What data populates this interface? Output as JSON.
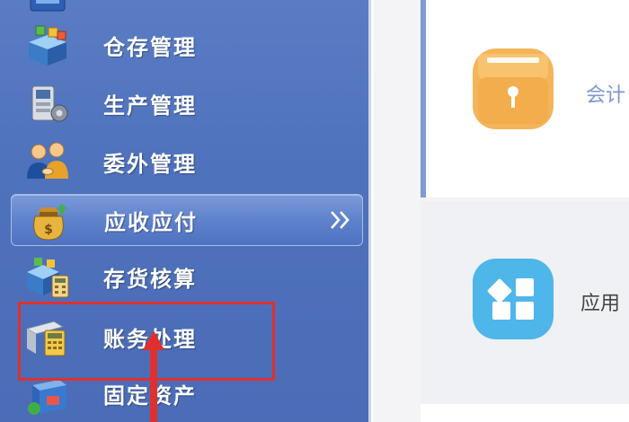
{
  "sidebar": {
    "items": [
      {
        "label": "",
        "icon": "partial-top-icon"
      },
      {
        "label": "仓存管理",
        "icon": "warehouse-boxes-icon"
      },
      {
        "label": "生产管理",
        "icon": "production-machine-icon"
      },
      {
        "label": "委外管理",
        "icon": "outsourcing-people-icon"
      },
      {
        "label": "应收应付",
        "icon": "money-bag-icon",
        "active": true,
        "chevron": "»"
      },
      {
        "label": "存货核算",
        "icon": "inventory-calculator-icon"
      },
      {
        "label": "账务处理",
        "icon": "ledger-calculator-icon",
        "highlighted": true
      },
      {
        "label": "固定资产",
        "icon": "fixed-assets-icon"
      }
    ]
  },
  "content": {
    "cards": [
      {
        "label": "会计",
        "icon": "folder-pin-icon",
        "color": "#f4b45a"
      },
      {
        "label": "应用",
        "icon": "app-grid-icon",
        "color": "#4fb6ea"
      }
    ]
  },
  "colors": {
    "sidebar_bg": "#4f72bd",
    "highlight_border": "#e0302e",
    "card_accent": "#7e9bd3"
  }
}
